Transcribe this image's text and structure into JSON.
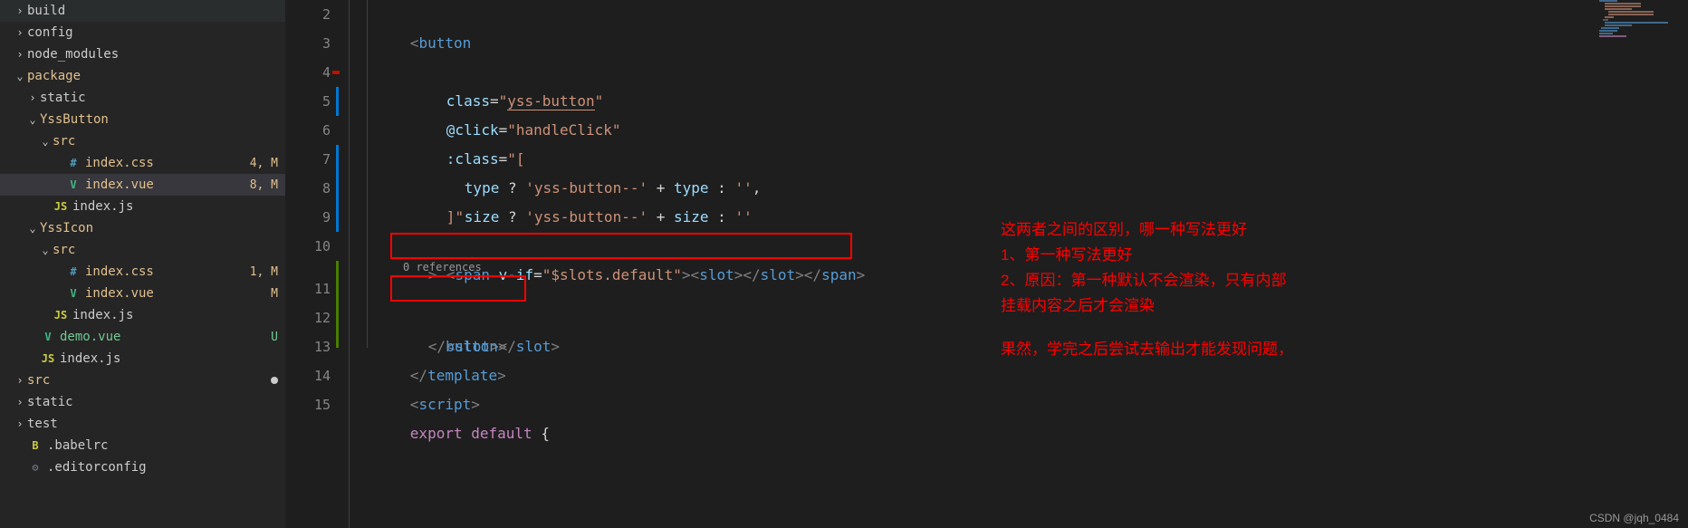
{
  "sidebar": {
    "items": [
      {
        "label": "build",
        "indent": 1,
        "chev": "›",
        "type": "folder",
        "mod": "",
        "class": ""
      },
      {
        "label": "config",
        "indent": 1,
        "chev": "›",
        "type": "folder",
        "mod": "",
        "class": ""
      },
      {
        "label": "node_modules",
        "indent": 1,
        "chev": "›",
        "type": "folder",
        "mod": "",
        "class": ""
      },
      {
        "label": "package",
        "indent": 1,
        "chev": "⌄",
        "type": "folder",
        "mod": "",
        "class": "modified"
      },
      {
        "label": "static",
        "indent": 2,
        "chev": "›",
        "type": "folder",
        "mod": "",
        "class": ""
      },
      {
        "label": "YssButton",
        "indent": 2,
        "chev": "⌄",
        "type": "folder",
        "mod": "",
        "class": "modified"
      },
      {
        "label": "src",
        "indent": 3,
        "chev": "⌄",
        "type": "folder",
        "mod": "",
        "class": "modified"
      },
      {
        "label": "index.css",
        "indent": 4,
        "chev": "",
        "type": "css",
        "mod": "4, M",
        "class": "modified"
      },
      {
        "label": "index.vue",
        "indent": 4,
        "chev": "",
        "type": "vue",
        "mod": "8, M",
        "class": "modified selected"
      },
      {
        "label": "index.js",
        "indent": 3,
        "chev": "",
        "type": "js",
        "mod": "",
        "class": ""
      },
      {
        "label": "YssIcon",
        "indent": 2,
        "chev": "⌄",
        "type": "folder",
        "mod": "",
        "class": "modified"
      },
      {
        "label": "src",
        "indent": 3,
        "chev": "⌄",
        "type": "folder",
        "mod": "",
        "class": "modified"
      },
      {
        "label": "index.css",
        "indent": 4,
        "chev": "",
        "type": "css",
        "mod": "1, M",
        "class": "modified"
      },
      {
        "label": "index.vue",
        "indent": 4,
        "chev": "",
        "type": "vue",
        "mod": "M",
        "class": "modified"
      },
      {
        "label": "index.js",
        "indent": 3,
        "chev": "",
        "type": "js",
        "mod": "",
        "class": ""
      },
      {
        "label": "demo.vue",
        "indent": 2,
        "chev": "",
        "type": "vue",
        "mod": "U",
        "class": "untracked"
      },
      {
        "label": "index.js",
        "indent": 2,
        "chev": "",
        "type": "js",
        "mod": "",
        "class": ""
      },
      {
        "label": "src",
        "indent": 1,
        "chev": "›",
        "type": "folder",
        "mod": "",
        "class": "modified",
        "dot": true
      },
      {
        "label": "static",
        "indent": 1,
        "chev": "›",
        "type": "folder",
        "mod": "",
        "class": ""
      },
      {
        "label": "test",
        "indent": 1,
        "chev": "›",
        "type": "folder",
        "mod": "",
        "class": ""
      },
      {
        "label": ".babelrc",
        "indent": 1,
        "chev": "",
        "type": "babel",
        "mod": "",
        "class": ""
      },
      {
        "label": ".editorconfig",
        "indent": 1,
        "chev": "",
        "type": "config",
        "mod": "",
        "class": ""
      }
    ]
  },
  "editor": {
    "codelens": "0 references",
    "line_numbers": [
      "2",
      "3",
      "4",
      "5",
      "6",
      "7",
      "8",
      "9",
      "10",
      "11",
      "12",
      "13",
      "14",
      "15"
    ],
    "tokens": {
      "l2": {
        "br1": "<",
        "tag": "button",
        "marker": ""
      },
      "l3": {
        "attr": "class",
        "eq": "=",
        "q1": "\"",
        "val": "yss-button",
        "q2": "\"",
        "marker": "blue"
      },
      "l4": {
        "attr": "@click",
        "eq": "=",
        "q1": "\"",
        "val": "handleClick",
        "q2": "\"",
        "marker": "red"
      },
      "l5": {
        "attr": ":class",
        "eq": "=",
        "q1": "\"",
        "val": "[",
        "marker": "blue"
      },
      "l6": {
        "id1": "type",
        "op1": " ? ",
        "s1": "'yss-button--'",
        "op2": " + ",
        "id2": "type",
        "op3": " : ",
        "s2": "''",
        "comma": ",",
        "marker": "blue"
      },
      "l7": {
        "id1": "size",
        "op1": " ? ",
        "s1": "'yss-button--'",
        "op2": " + ",
        "id2": "size",
        "op3": " : ",
        "s2": "''",
        "marker": "blue"
      },
      "l8": {
        "val": "]",
        "q": "\"",
        "marker": ""
      },
      "l9": {
        "br": ">",
        "marker": "green"
      },
      "l10": {
        "br1": "<",
        "tag1": "span",
        "sp": " ",
        "attr": "v-if",
        "eq": "=",
        "q1": "\"",
        "val": "$slots.default",
        "q2": "\"",
        "br2": "><",
        "tag2": "slot",
        "br3": "></",
        "tag3": "slot",
        "br4": "></",
        "tag4": "span",
        "br5": ">",
        "marker": "green"
      },
      "l11": {
        "br1": "<",
        "tag1": "slot",
        "br2": "></",
        "tag2": "slot",
        "br3": ">",
        "marker": "green"
      },
      "l12": {
        "br1": "</",
        "tag": "button",
        "br2": ">",
        "marker": ""
      },
      "l13": {
        "br1": "</",
        "tag": "template",
        "br2": ">",
        "marker": ""
      },
      "l14": {
        "br1": "<",
        "tag": "script",
        "br2": ">",
        "marker": ""
      },
      "l15": {
        "kw": "export",
        "sp": " ",
        "kw2": "default",
        "sp2": " ",
        "br": "{",
        "marker": ""
      }
    }
  },
  "annotations": {
    "line1": "这两者之间的区别，哪一种写法更好",
    "line2": "1、第一种写法更好",
    "line3": "2、原因：第一种默认不会渲染，只有内部",
    "line4": "挂载内容之后才会渲染",
    "line5": "果然，学完之后尝试去输出才能发现问题，"
  },
  "watermark": "CSDN @jqh_0484"
}
